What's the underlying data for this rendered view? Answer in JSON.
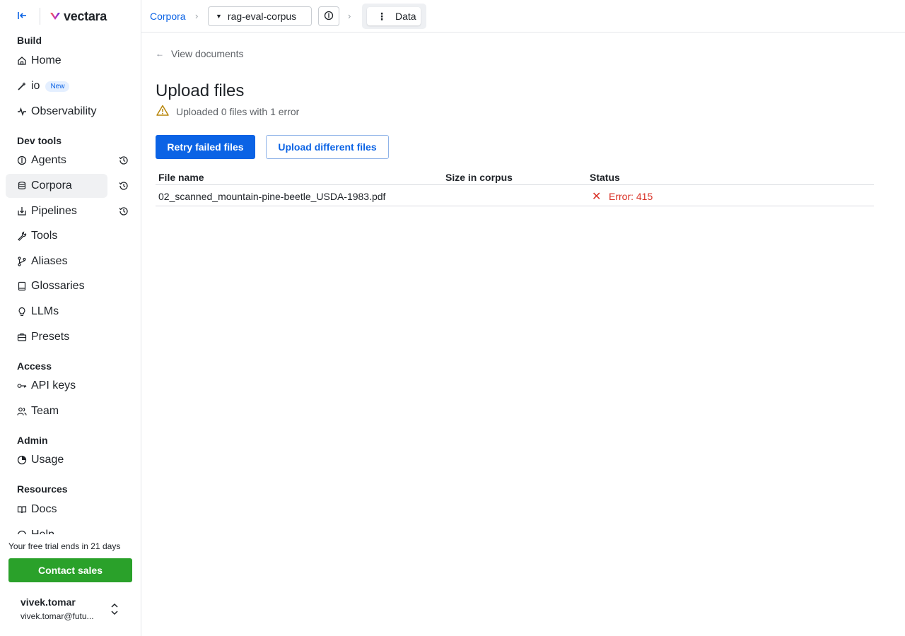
{
  "brand": {
    "name": "vectara"
  },
  "sidebar": {
    "sections": {
      "build": "Build",
      "dev_tools": "Dev tools",
      "access": "Access",
      "admin": "Admin",
      "resources": "Resources"
    },
    "items": {
      "home": "Home",
      "io": "io",
      "io_badge": "New",
      "observability": "Observability",
      "agents": "Agents",
      "corpora": "Corpora",
      "pipelines": "Pipelines",
      "tools": "Tools",
      "aliases": "Aliases",
      "glossaries": "Glossaries",
      "llms": "LLMs",
      "presets": "Presets",
      "api_keys": "API keys",
      "team": "Team",
      "usage": "Usage",
      "docs": "Docs",
      "help": "Help"
    },
    "active_item": "Corpora",
    "trial_text": "Your free trial ends in 21 days",
    "contact_sales": "Contact sales",
    "user": {
      "name": "vivek.tomar",
      "email": "vivek.tomar@futu..."
    }
  },
  "topbar": {
    "breadcrumb_root": "Corpora",
    "corpus_name": "rag-eval-corpus",
    "tab_label": "Data"
  },
  "main": {
    "back_label": "View documents",
    "title": "Upload files",
    "status": "Uploaded 0 files with 1 error",
    "retry_label": "Retry failed files",
    "upload_label": "Upload different files",
    "table": {
      "headers": [
        "File name",
        "Size in corpus",
        "Status"
      ],
      "rows": [
        {
          "file_name": "02_scanned_mountain-pine-beetle_USDA-1983.pdf",
          "size": "",
          "status": "Error: 415"
        }
      ]
    }
  },
  "colors": {
    "accent": "#0b63e5",
    "success": "#2aa12a",
    "error": "#d93025",
    "warning": "#b8860b"
  }
}
